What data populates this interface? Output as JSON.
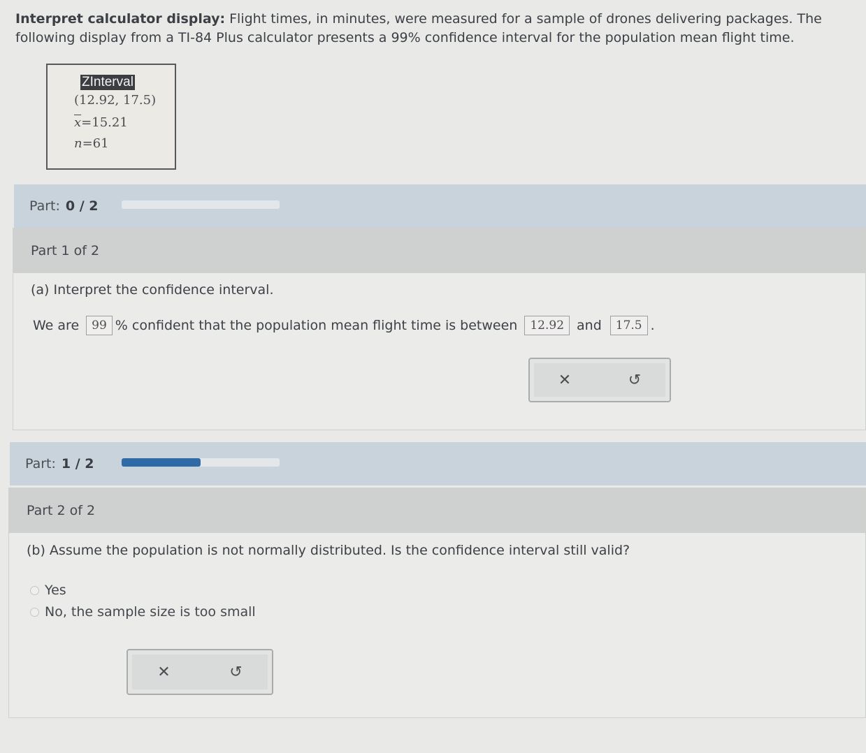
{
  "intro": {
    "bold": "Interpret calculator display:",
    "text": " Flight times, in minutes, were measured for a sample of drones delivering packages. The following display from a TI-84 Plus calculator presents a 99% confidence interval for the population mean flight time."
  },
  "calculator": {
    "title": "ZInterval",
    "interval": "(12.92, 17.5)",
    "xbar_symbol": "x",
    "xbar_value": "=15.21",
    "n_symbol": "n",
    "n_value": "=61"
  },
  "part_bar_1": {
    "label": "Part:",
    "progress": "0 / 2",
    "fraction": 0.0
  },
  "part1": {
    "heading": "Part 1 of 2",
    "question": "(a) Interpret the confidence interval.",
    "sentence_start": "We are",
    "answer_confidence": "99",
    "sentence_mid": "% confident that the population mean flight time is between",
    "answer_lower": "12.92",
    "sentence_and": "and",
    "answer_upper": "17.5",
    "sentence_end": ".",
    "clear_icon": "✕",
    "reset_icon": "↺"
  },
  "part_bar_2": {
    "label": "Part:",
    "progress": "1 / 2",
    "fraction": 0.5
  },
  "part2": {
    "heading": "Part 2 of 2",
    "question": "(b) Assume the population is not normally distributed. Is the confidence interval still valid?",
    "options": [
      "Yes",
      "No, the sample size is too small"
    ],
    "clear_icon": "✕",
    "reset_icon": "↺"
  },
  "colors": {
    "progress_fill": "#2f6aa6",
    "part_bar": "#c9d3dc"
  }
}
